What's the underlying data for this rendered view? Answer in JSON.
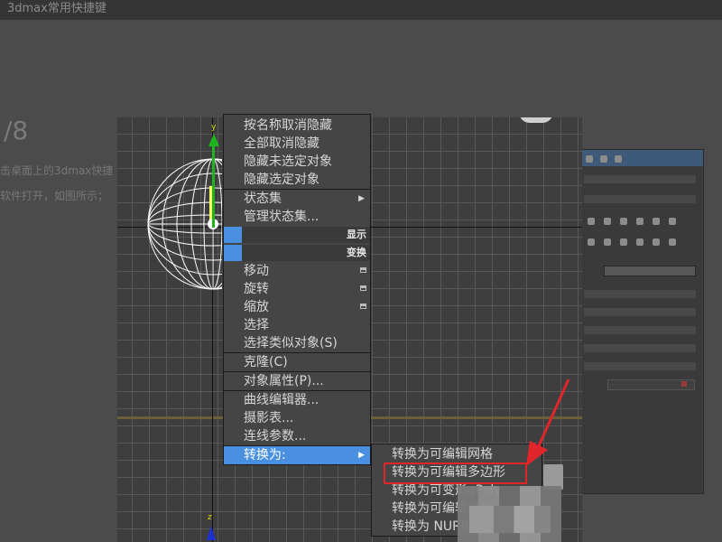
{
  "background_page": {
    "topbar_text": "3dmax常用快捷键",
    "step_text": "/8",
    "line1": "击桌面上的3dmax快捷",
    "line2": "软件打开，如图所示；"
  },
  "viewport": {
    "axis_label_top": "y",
    "axis_label_bottom": "z"
  },
  "quad_menu": {
    "top_items": [
      {
        "label": "按名称取消隐藏"
      },
      {
        "label": "全部取消隐藏"
      },
      {
        "label": "隐藏未选定对象"
      },
      {
        "label": "隐藏选定对象"
      },
      {
        "label": "状态集"
      },
      {
        "label": "管理状态集..."
      }
    ],
    "header_display": "显示",
    "header_transform": "变换",
    "transform_items": [
      {
        "label": "移动"
      },
      {
        "label": "旋转"
      },
      {
        "label": "缩放"
      },
      {
        "label": "选择"
      },
      {
        "label": "选择类似对象(S)"
      },
      {
        "label": "克隆(C)"
      },
      {
        "label": "对象属性(P)..."
      },
      {
        "label": "曲线编辑器..."
      },
      {
        "label": "摄影表..."
      },
      {
        "label": "连线参数..."
      },
      {
        "label": "转换为:"
      }
    ]
  },
  "submenu": {
    "items": [
      {
        "label": "转换为可编辑网格"
      },
      {
        "label": "转换为可编辑多边形"
      },
      {
        "label": "转换为可变形gPoly"
      },
      {
        "label": "转换为可编辑面片"
      },
      {
        "label": "转换为 NURBS"
      }
    ],
    "highlighted_index": 1
  },
  "colors": {
    "highlight": "#4a90e0",
    "annotation_red": "#e0262b"
  }
}
